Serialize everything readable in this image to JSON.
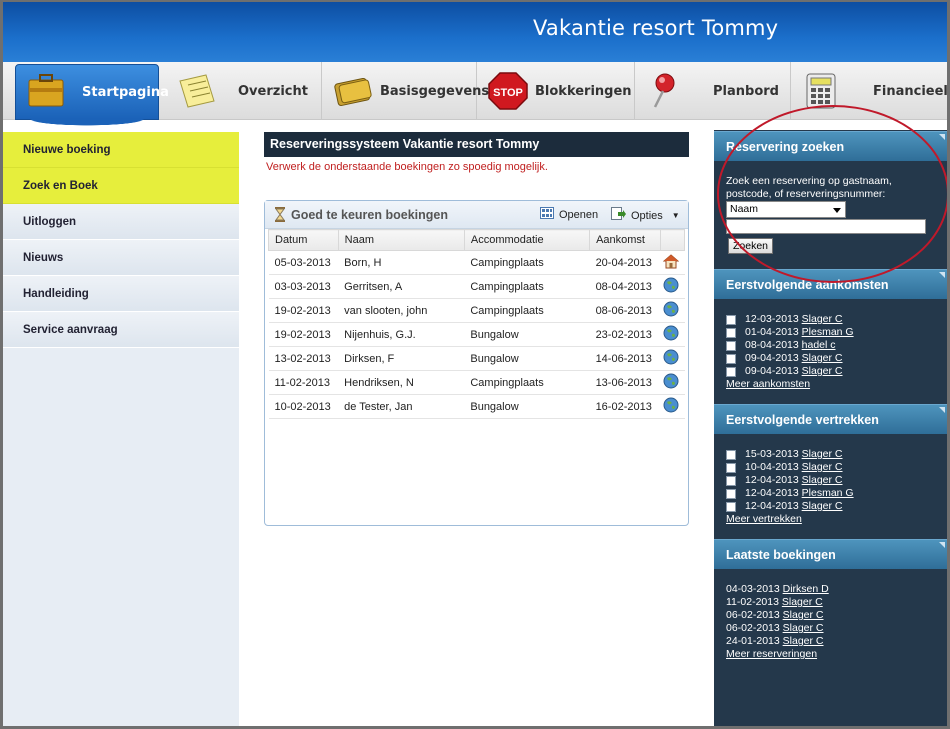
{
  "app": {
    "title": "Vakantie resort Tommy"
  },
  "nav": {
    "tabs": [
      {
        "label": "Startpagina",
        "icon": "briefcase-icon"
      },
      {
        "label": "Overzicht",
        "icon": "notes-icon"
      },
      {
        "label": "Basisgegevens",
        "icon": "folder-icon"
      },
      {
        "label": "Blokkeringen",
        "icon": "stop-sign-icon"
      },
      {
        "label": "Planbord",
        "icon": "pushpin-icon"
      },
      {
        "label": "Financieel",
        "icon": "calculator-icon"
      }
    ]
  },
  "sidebar": {
    "items": [
      {
        "label": "Nieuwe boeking"
      },
      {
        "label": "Zoek en Boek"
      },
      {
        "label": "Uitloggen"
      },
      {
        "label": "Nieuws"
      },
      {
        "label": "Handleiding"
      },
      {
        "label": "Service aanvraag"
      }
    ]
  },
  "main": {
    "title": "Reserveringssysteem Vakantie resort Tommy",
    "note": "Verwerk de onderstaande boekingen zo spoedig mogelijk.",
    "panel": {
      "title": "Goed te keuren boekingen",
      "open_label": "Openen",
      "options_label": "Opties",
      "columns": [
        "Datum",
        "Naam",
        "Accommodatie",
        "Aankomst"
      ],
      "rows": [
        {
          "datum": "05-03-2013",
          "naam": "Born, H",
          "accommodatie": "Campingplaats",
          "aankomst": "20-04-2013",
          "icon": "home-icon"
        },
        {
          "datum": "03-03-2013",
          "naam": "Gerritsen, A",
          "accommodatie": "Campingplaats",
          "aankomst": "08-04-2013",
          "icon": "globe-icon"
        },
        {
          "datum": "19-02-2013",
          "naam": "van slooten, john",
          "accommodatie": "Campingplaats",
          "aankomst": "08-06-2013",
          "icon": "globe-icon"
        },
        {
          "datum": "19-02-2013",
          "naam": "Nijenhuis, G.J.",
          "accommodatie": "Bungalow",
          "aankomst": "23-02-2013",
          "icon": "globe-icon"
        },
        {
          "datum": "13-02-2013",
          "naam": "Dirksen, F",
          "accommodatie": "Bungalow",
          "aankomst": "14-06-2013",
          "icon": "globe-icon"
        },
        {
          "datum": "11-02-2013",
          "naam": "Hendriksen, N",
          "accommodatie": "Campingplaats",
          "aankomst": "13-06-2013",
          "icon": "globe-icon"
        },
        {
          "datum": "10-02-2013",
          "naam": "de Tester, Jan",
          "accommodatie": "Bungalow",
          "aankomst": "16-02-2013",
          "icon": "globe-icon"
        }
      ]
    }
  },
  "right": {
    "search": {
      "title": "Reservering zoeken",
      "hint_line1": "Zoek een reservering op gastnaam,",
      "hint_line2": "postcode, of reserveringsnummer:",
      "select_value": "Naam",
      "input_value": "",
      "button_label": "Zoeken"
    },
    "arrivals": {
      "title": "Eerstvolgende aankomsten",
      "items": [
        {
          "date": "12-03-2013",
          "name": "Slager C"
        },
        {
          "date": "01-04-2013",
          "name": "Plesman G"
        },
        {
          "date": "08-04-2013",
          "name": "hadel c"
        },
        {
          "date": "09-04-2013",
          "name": "Slager C"
        },
        {
          "date": "09-04-2013",
          "name": "Slager C"
        }
      ],
      "more": "Meer aankomsten"
    },
    "departures": {
      "title": "Eerstvolgende vertrekken",
      "items": [
        {
          "date": "15-03-2013",
          "name": "Slager C"
        },
        {
          "date": "10-04-2013",
          "name": "Slager C"
        },
        {
          "date": "12-04-2013",
          "name": "Slager C"
        },
        {
          "date": "12-04-2013",
          "name": "Plesman G"
        },
        {
          "date": "12-04-2013",
          "name": "Slager C"
        }
      ],
      "more": "Meer vertrekken"
    },
    "latest": {
      "title": "Laatste boekingen",
      "items": [
        {
          "date": "04-03-2013",
          "name": "Dirksen D"
        },
        {
          "date": "11-02-2013",
          "name": "Slager C"
        },
        {
          "date": "06-02-2013",
          "name": "Slager C"
        },
        {
          "date": "06-02-2013",
          "name": "Slager C"
        },
        {
          "date": "24-01-2013",
          "name": "Slager C"
        }
      ],
      "more": "Meer reserveringen"
    }
  },
  "colors": {
    "header_blue": "#1b6fcb",
    "highlight_yellow": "#e6ee3c",
    "warning_red": "#c02020",
    "right_panel": "#24384b",
    "annotation_circle": "#c0192a"
  }
}
